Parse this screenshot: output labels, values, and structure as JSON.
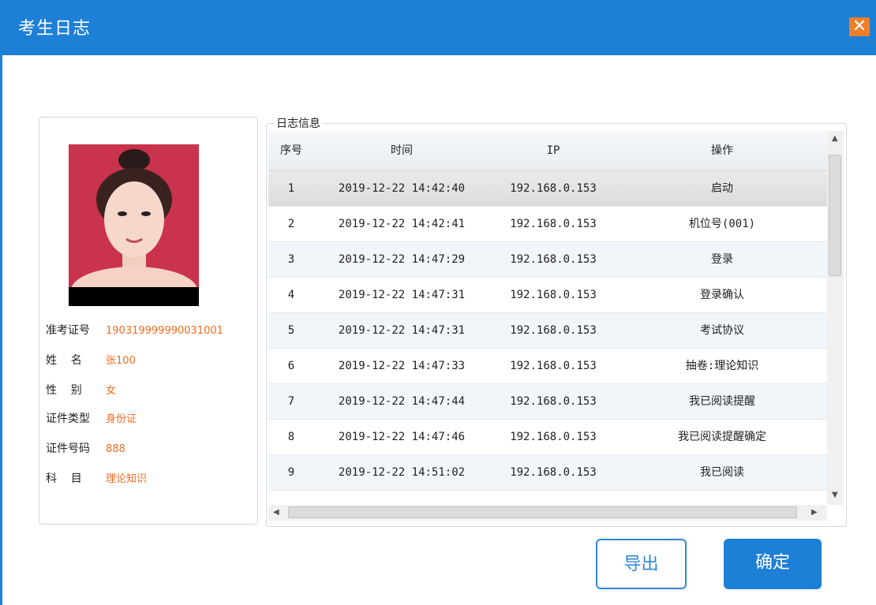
{
  "window": {
    "title": "考生日志",
    "close_glyph": "✕"
  },
  "profile": {
    "fields": [
      {
        "label": "准考证号",
        "value": "190319999990031001"
      },
      {
        "label": "姓    名",
        "value": "张100"
      },
      {
        "label": "性    别",
        "value": "女"
      },
      {
        "label": "证件类型",
        "value": "身份证"
      },
      {
        "label": "证件号码",
        "value": "888"
      },
      {
        "label": "科    目",
        "value": "理论知识"
      }
    ]
  },
  "log": {
    "group_title": "日志信息",
    "columns": [
      "序号",
      "时间",
      "IP",
      "操作"
    ],
    "rows": [
      {
        "idx": "1",
        "time": "2019-12-22 14:42:40",
        "ip": "192.168.0.153",
        "op": "启动"
      },
      {
        "idx": "2",
        "time": "2019-12-22 14:42:41",
        "ip": "192.168.0.153",
        "op": "机位号(001)"
      },
      {
        "idx": "3",
        "time": "2019-12-22 14:47:29",
        "ip": "192.168.0.153",
        "op": "登录"
      },
      {
        "idx": "4",
        "time": "2019-12-22 14:47:31",
        "ip": "192.168.0.153",
        "op": "登录确认"
      },
      {
        "idx": "5",
        "time": "2019-12-22 14:47:31",
        "ip": "192.168.0.153",
        "op": "考试协议"
      },
      {
        "idx": "6",
        "time": "2019-12-22 14:47:33",
        "ip": "192.168.0.153",
        "op": "抽卷:理论知识"
      },
      {
        "idx": "7",
        "time": "2019-12-22 14:47:44",
        "ip": "192.168.0.153",
        "op": "我已阅读提醒"
      },
      {
        "idx": "8",
        "time": "2019-12-22 14:47:46",
        "ip": "192.168.0.153",
        "op": "我已阅读提醒确定"
      },
      {
        "idx": "9",
        "time": "2019-12-22 14:51:02",
        "ip": "192.168.0.153",
        "op": "我已阅读"
      }
    ]
  },
  "buttons": {
    "export": "导出",
    "ok": "确定"
  }
}
